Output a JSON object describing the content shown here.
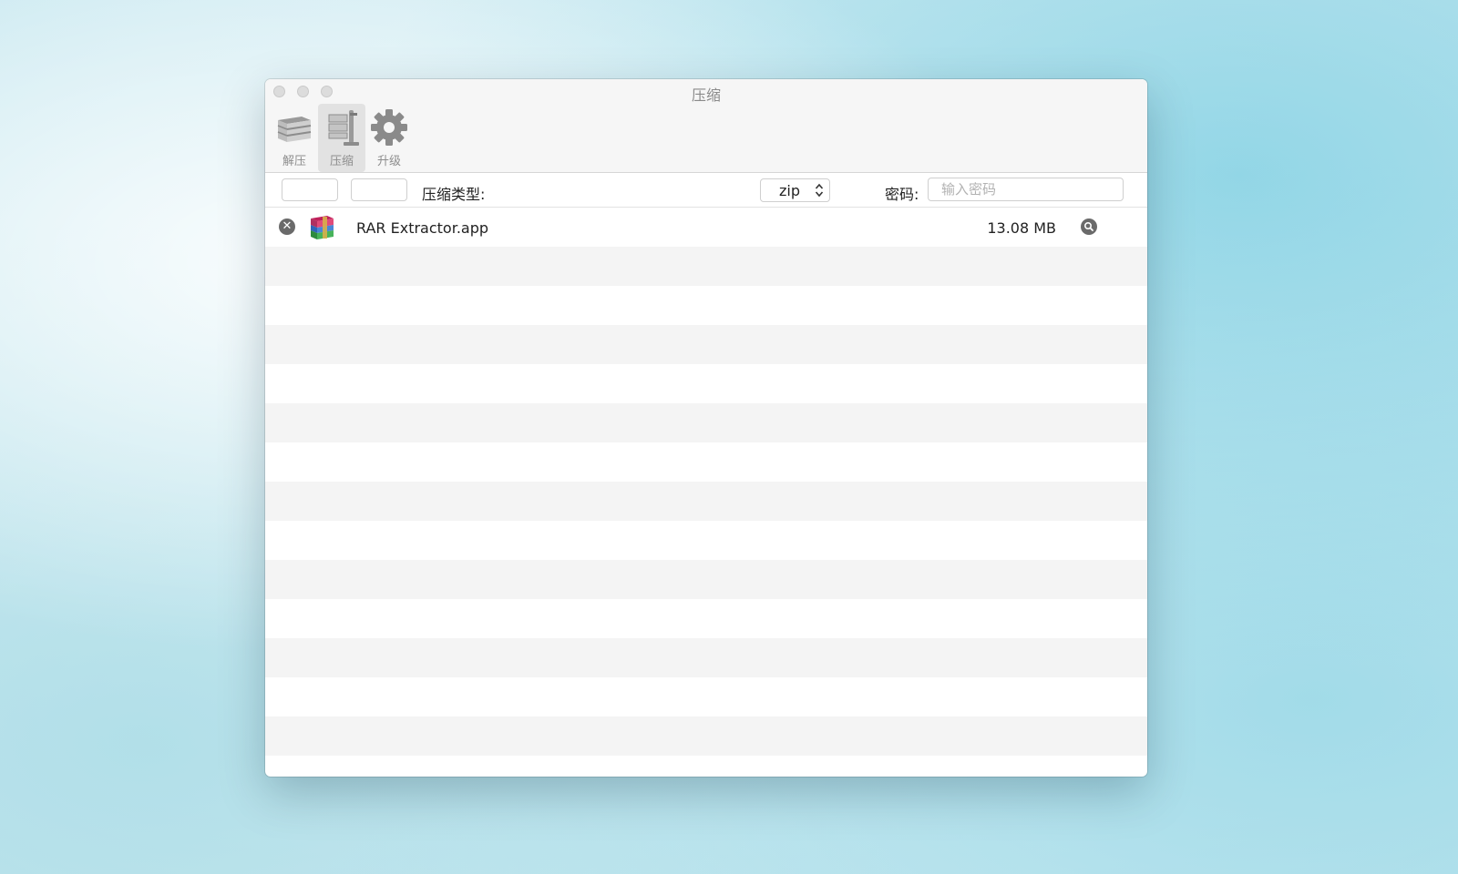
{
  "window": {
    "title": "压缩"
  },
  "toolbar": {
    "items": [
      {
        "label": "解压",
        "icon": "books-icon",
        "active": false
      },
      {
        "label": "压缩",
        "icon": "vise-icon",
        "active": true
      },
      {
        "label": "升级",
        "icon": "gear-icon",
        "active": false
      }
    ]
  },
  "options": {
    "compress_type_label": "压缩类型:",
    "compress_type_value": "zip",
    "password_label": "密码:",
    "password_placeholder": "输入密码",
    "password_value": ""
  },
  "files": [
    {
      "name": "RAR Extractor.app",
      "size": "13.08 MB",
      "icon": "archive-books-icon"
    }
  ]
}
